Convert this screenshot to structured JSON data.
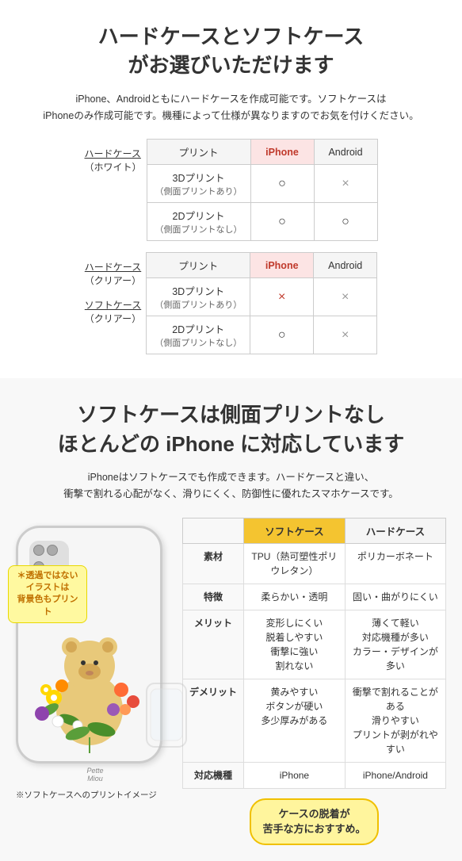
{
  "section1": {
    "title": "ハードケースとソフトケース\nがお選びいただけます",
    "description": "iPhone、Androidともにハードケースを作成可能です。ソフトケースは\niPhoneのみ作成可能です。機種によって仕様が異なりますのでお気を付けください。",
    "table1": {
      "col_print": "プリント",
      "col_iphone": "iPhone",
      "col_android": "Android",
      "hard_case_label": "ハードケース\n（ホワイト）",
      "hard_case_rows": [
        {
          "print": "3Dプリント\n（側面プリントあり）",
          "iphone": "○",
          "android": "×"
        },
        {
          "print": "2Dプリント\n（側面プリントなし）",
          "iphone": "○",
          "android": "○"
        }
      ]
    },
    "table2": {
      "col_print": "プリント",
      "col_iphone": "iPhone",
      "col_android": "Android",
      "hard_clear_label": "ハードケース\n（クリアー）",
      "soft_clear_label": "ソフトケース\n（クリアー）",
      "rows": [
        {
          "print": "3Dプリント\n（側面プリントあり）",
          "iphone": "×",
          "android": "×"
        },
        {
          "print": "2Dプリント\n（側面プリントなし）",
          "iphone": "○",
          "android": "×"
        }
      ]
    }
  },
  "section2": {
    "title": "ソフトケースは側面プリントなし\nほとんどの iPhone に対応しています",
    "description": "iPhoneはソフトケースでも作成できます。ハードケースと違い、\n衝撃で割れる心配がなく、滑りにくく、防御性に優れたスマホケースです。",
    "notice_bubble": "＊透過ではないイラストは\n背景色もプリント",
    "phone_brand": "Pette\nMiou",
    "footnote": "※ソフトケースへのプリントイメージ",
    "tip_bubble": "ケースの脱着が\n苦手な方におすすめ。",
    "comp_table": {
      "headers": [
        "",
        "ソフトケース",
        "ハードケース"
      ],
      "rows": [
        {
          "label": "素材",
          "soft": "TPU（熱可塑性ポリウレタン）",
          "hard": "ポリカーボネート"
        },
        {
          "label": "特徴",
          "soft": "柔らかい・透明",
          "hard": "固い・曲がりにくい"
        },
        {
          "label": "メリット",
          "soft": "変形しにくい\n脱着しやすい\n衝撃に強い\n割れない",
          "hard": "薄くて軽い\n対応機種が多い\nカラー・デザインが多い"
        },
        {
          "label": "デメリット",
          "soft": "黄みやすい\nボタンが硬い\n多少厚みがある",
          "hard": "衝撃で割れることがある\n滑りやすい\nプリントが剥がれやすい"
        },
        {
          "label": "対応機種",
          "soft": "iPhone",
          "hard": "iPhone/Android"
        }
      ]
    }
  }
}
